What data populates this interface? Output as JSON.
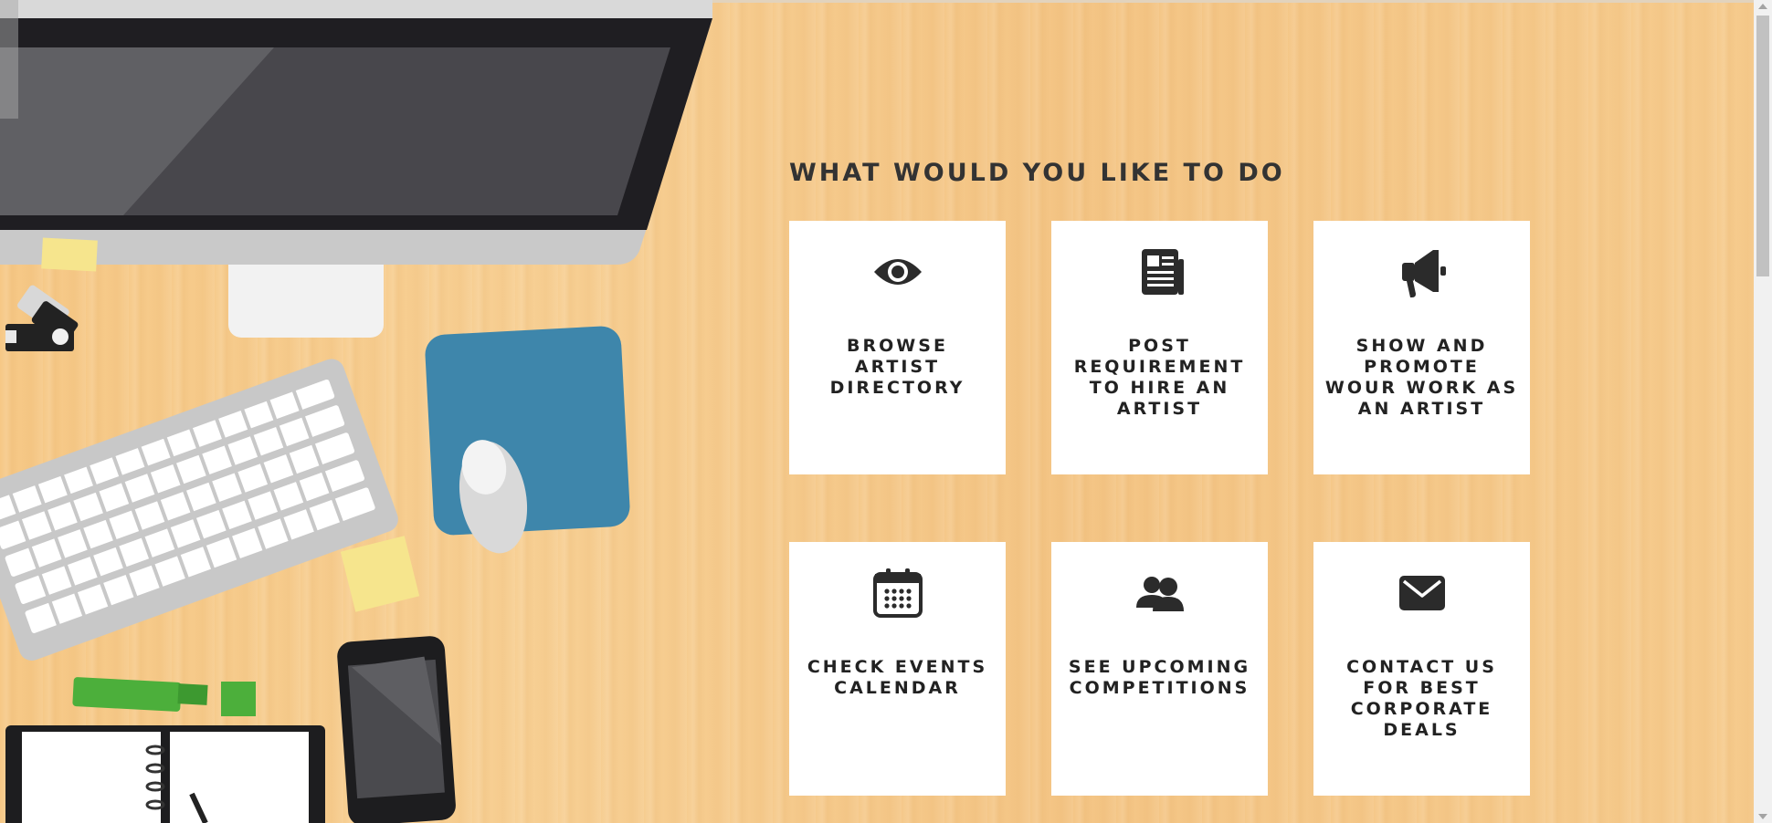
{
  "page": {
    "heading": "WHAT WOULD YOU LIKE TO DO"
  },
  "cards": [
    {
      "label": "BROWSE ARTIST DIRECTORY",
      "icon": "eye-icon"
    },
    {
      "label": "POST REQUIREMENT TO HIRE AN ARTIST",
      "icon": "newspaper-icon"
    },
    {
      "label": "SHOW AND PROMOTE WOUR WORK AS AN ARTIST",
      "icon": "megaphone-icon"
    },
    {
      "label": "CHECK EVENTS CALENDAR",
      "icon": "calendar-icon"
    },
    {
      "label": "SEE UPCOMING COMPETITIONS",
      "icon": "users-icon"
    },
    {
      "label": "CONTACT US FOR BEST CORPORATE DEALS",
      "icon": "envelope-icon"
    }
  ],
  "colors": {
    "background": "#f6c886",
    "card": "#ffffff",
    "text": "#222222",
    "icon": "#2b2b2b"
  }
}
